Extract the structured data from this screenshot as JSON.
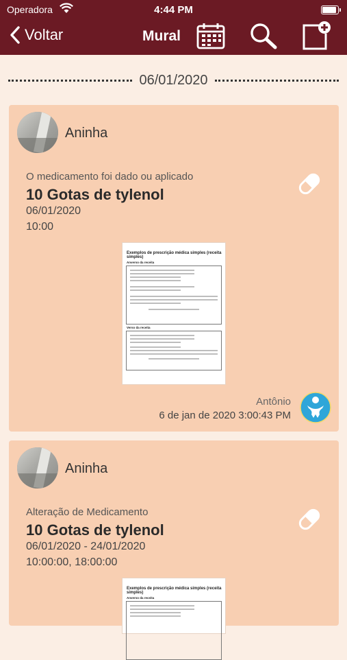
{
  "status_bar": {
    "carrier": "Operadora",
    "time": "4:44 PM"
  },
  "nav": {
    "back_label": "Voltar",
    "title": "Mural"
  },
  "date_separator": "06/01/2020",
  "posts": [
    {
      "user": "Aninha",
      "type": "O medicamento foi dado ou aplicado",
      "title": "10 Gotas de tylenol",
      "date_line": "06/01/2020",
      "time_line": "10:00",
      "author": "Antônio",
      "timestamp": "6 de jan de 2020 3:00:43 PM"
    },
    {
      "user": "Aninha",
      "type": "Alteração de Medicamento",
      "title": "10 Gotas de tylenol",
      "date_line": "06/01/2020 - 24/01/2020",
      "time_line": "10:00:00, 18:00:00"
    }
  ],
  "prescription": {
    "title": "Exemplos de prescrição médica simples (receita simples)",
    "front_label": "Anverso da receita",
    "back_label": "Verso da receita"
  },
  "colors": {
    "header": "#6b1a24",
    "card": "#f8cfb2",
    "background": "#fbeee4"
  },
  "icons": [
    "wifi-icon",
    "battery-icon",
    "back-chevron-icon",
    "calendar-icon",
    "search-icon",
    "new-post-icon",
    "pill-icon",
    "baby-avatar-icon"
  ]
}
